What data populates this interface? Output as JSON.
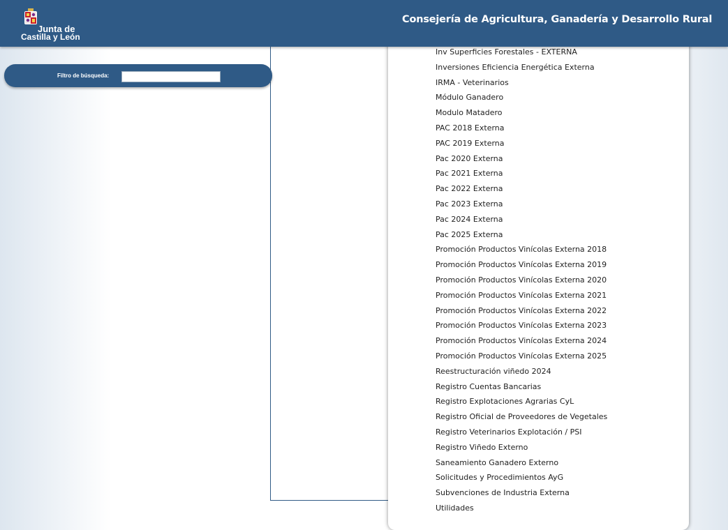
{
  "header": {
    "logo_line1": "Junta de",
    "logo_line2": "Castilla y León",
    "title": "Consejería de Agricultura, Ganadería y Desarrollo Rural"
  },
  "filter": {
    "label": "Filtro de búsqueda:",
    "value": ""
  },
  "menu": {
    "items": [
      "Inv Superficies Forestales - EXTERNA",
      "Inversiones Eficiencia Energética Externa",
      "IRMA - Veterinarios",
      "Módulo Ganadero",
      "Modulo Matadero",
      "PAC 2018 Externa",
      "PAC 2019 Externa",
      "Pac 2020 Externa",
      "Pac 2021 Externa",
      "Pac 2022 Externa",
      "Pac 2023 Externa",
      "Pac 2024 Externa",
      "Pac 2025 Externa",
      "Promoción Productos Vinícolas Externa 2018",
      "Promoción Productos Vinícolas Externa 2019",
      "Promoción Productos Vinícolas Externa 2020",
      "Promoción Productos Vinícolas Externa 2021",
      "Promoción Productos Vinícolas Externa 2022",
      "Promoción Productos Vinícolas Externa 2023",
      "Promoción Productos Vinícolas Externa 2024",
      "Promoción Productos Vinícolas Externa 2025",
      "Reestructuración viñedo 2024",
      "Registro Cuentas Bancarias",
      "Registro Explotaciones Agrarias CyL",
      "Registro Oficial de Proveedores de Vegetales",
      "Registro Veterinarios Explotación / PSI",
      "Registro Viñedo Externo",
      "Saneamiento Ganadero Externo",
      "Solicitudes y Procedimientos AyG",
      "Subvenciones de Industria Externa",
      "Utilidades"
    ]
  },
  "colors": {
    "header_bg": "#2f5a86",
    "text": "#222222"
  }
}
